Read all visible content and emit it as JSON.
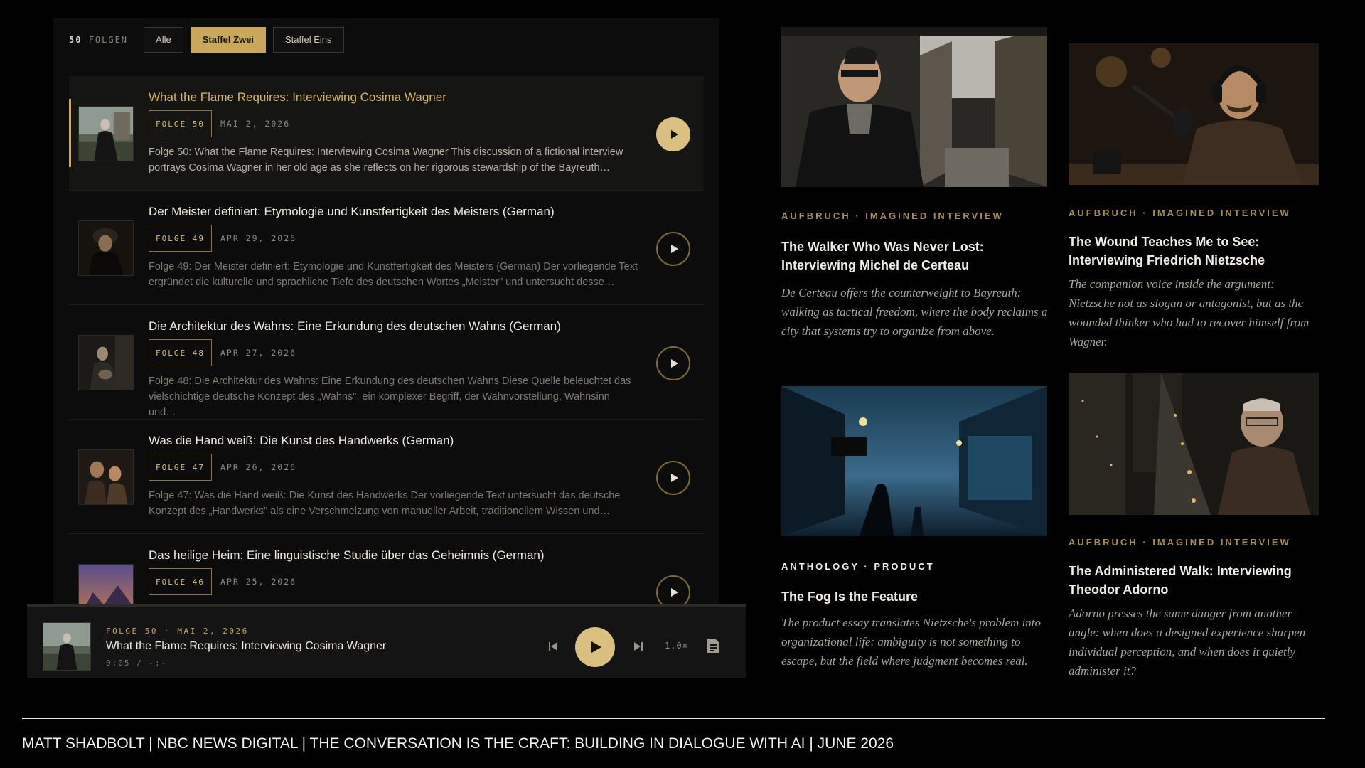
{
  "filter": {
    "count": "50",
    "count_label": "FOLGEN",
    "chips": [
      "Alle",
      "Staffel Zwei",
      "Staffel Eins"
    ],
    "active_chip": "Staffel Zwei"
  },
  "episodes": [
    {
      "title": "What the Flame Requires: Interviewing Cosima Wagner",
      "folge": "FOLGE 50",
      "date": "MAI 2, 2026",
      "desc": "Folge 50: What the Flame Requires: Interviewing Cosima Wagner This discussion of a fictional interview portrays Cosima Wagner in her old age as she reflects on her rigorous stewardship of the Bayreuth…"
    },
    {
      "title": "Der Meister definiert: Etymologie und Kunstfertigkeit des Meisters (German)",
      "folge": "FOLGE 49",
      "date": "APR 29, 2026",
      "desc": "Folge 49: Der Meister definiert: Etymologie und Kunstfertigkeit des Meisters (German) Der vorliegende Text ergründet die kulturelle und sprachliche Tiefe des deutschen Wortes „Meister\" und untersucht desse…"
    },
    {
      "title": "Die Architektur des Wahns: Eine Erkundung des deutschen Wahns (German)",
      "folge": "FOLGE 48",
      "date": "APR 27, 2026",
      "desc": "Folge 48: Die Architektur des Wahns: Eine Erkundung des deutschen Wahns Diese Quelle beleuchtet das vielschichtige deutsche Konzept des „Wahns\", ein komplexer Begriff, der Wahnvorstellung, Wahnsinn und…"
    },
    {
      "title": "Was die Hand weiß: Die Kunst des Handwerks (German)",
      "folge": "FOLGE 47",
      "date": "APR 26, 2026",
      "desc": "Folge 47: Was die Hand weiß: Die Kunst des Handwerks Der vorliegende Text untersucht das deutsche Konzept des „Handwerks\" als eine Verschmelzung von manueller Arbeit, traditionellem Wissen und…"
    },
    {
      "title": "Das heilige Heim: Eine linguistische Studie über das Geheimnis (German)",
      "folge": "FOLGE 46",
      "date": "APR 25, 2026",
      "desc": ""
    }
  ],
  "player": {
    "meta": "FOLGE 50 · MAI 2, 2026",
    "title": "What the Flame Requires: Interviewing Cosima Wagner",
    "time": "0:05  /  -:-",
    "speed": "1.0×"
  },
  "cards": [
    {
      "kicker": "AUFBRUCH · IMAGINED INTERVIEW",
      "title": "The Walker Who Was Never Lost: Interviewing Michel de Certeau",
      "desc": "De Certeau offers the counterweight to Bayreuth: walking as tactical freedom, where the body reclaims a city that systems try to organize from above."
    },
    {
      "kicker": "AUFBRUCH · IMAGINED INTERVIEW",
      "title": "The Wound Teaches Me to See: Interviewing Friedrich Nietzsche",
      "desc": "The companion voice inside the argument: Nietzsche not as slogan or antagonist, but as the wounded thinker who had to recover himself from Wagner."
    },
    {
      "kicker": "ANTHOLOGY · PRODUCT",
      "title": "The Fog Is the Feature",
      "desc": "The product essay translates Nietzsche's problem into organizational life: ambiguity is not something to escape, but the field where judgment becomes real."
    },
    {
      "kicker": "AUFBRUCH · IMAGINED INTERVIEW",
      "title": "The Administered Walk: Interviewing Theodor Adorno",
      "desc": "Adorno presses the same danger from another angle: when does a designed experience sharpen individual perception, and when does it quietly administer it?"
    }
  ],
  "footer": "MATT SHADBOLT | NBC NEWS DIGITAL | THE CONVERSATION IS THE CRAFT: BUILDING IN DIALOGUE WITH AI | JUNE 2026",
  "colors": {
    "accent": "#c9a85a",
    "background": "#000000",
    "panel": "#0c0c0c"
  }
}
